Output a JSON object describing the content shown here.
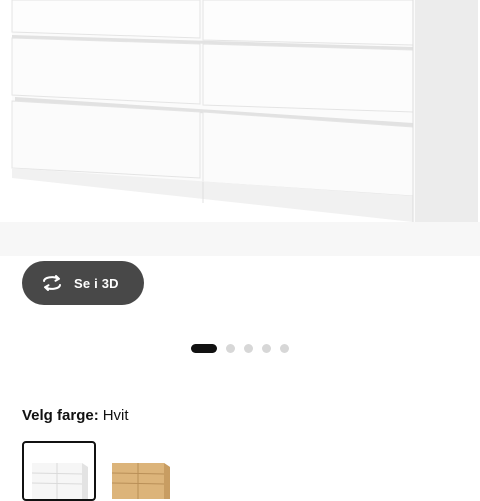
{
  "product": {
    "image": {
      "alt_icon": "dresser-white-image",
      "current_index": 1,
      "total_images": 5
    },
    "view_3d_button": {
      "label": "Se i 3D",
      "icon": "rotate-3d-icon"
    },
    "colors": {
      "key_label": "Velg farge:",
      "selected_value": "Hvit",
      "swatches": [
        {
          "name": "white-swatch",
          "color": "#ffffff",
          "selected": true
        },
        {
          "name": "oak-swatch",
          "color": "#d9b37c",
          "selected": false
        }
      ]
    }
  },
  "theme": {
    "button_bg": "#484848",
    "dot_active": "#111111",
    "dot_inactive": "#d7d7d7"
  }
}
